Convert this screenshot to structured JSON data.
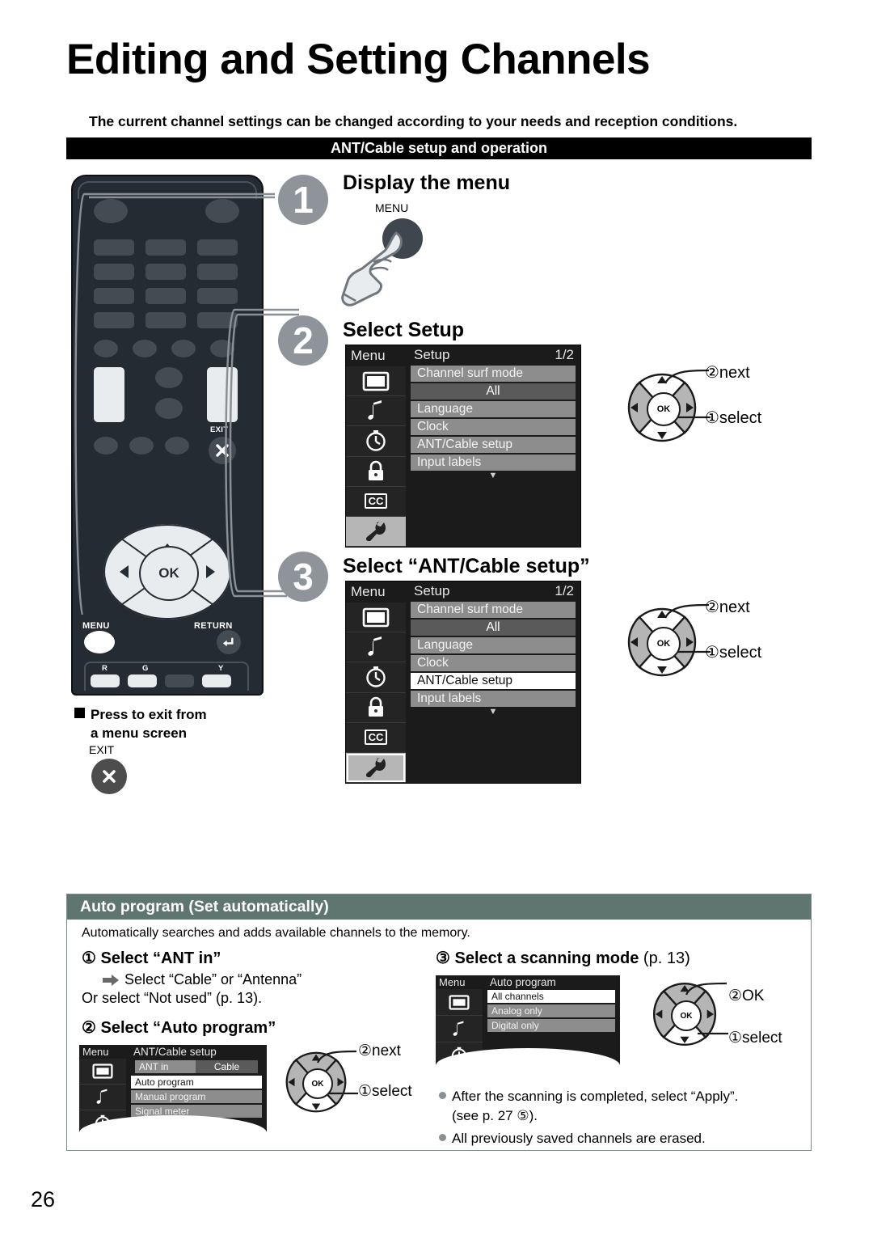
{
  "page": {
    "title": "Editing and Setting Channels",
    "lead": "The current channel settings can be changed according to your needs and reception conditions.",
    "section_bar": "ANT/Cable setup and operation",
    "page_number": "26"
  },
  "steps": [
    {
      "badge": "1",
      "title": "Display the menu",
      "button_label": "MENU"
    },
    {
      "badge": "2",
      "title": "Select Setup"
    },
    {
      "badge": "3",
      "title": "Select “ANT/Cable setup”"
    }
  ],
  "remote": {
    "labels": {
      "exit": "EXIT",
      "menu": "MENU",
      "return": "RETURN",
      "ok": "OK",
      "r": "R",
      "g": "G",
      "y": "Y"
    }
  },
  "exit_note": {
    "line1": "Press to exit from",
    "line2": "a menu screen",
    "button_label": "EXIT"
  },
  "menu_setup_1": {
    "side_title": "Menu",
    "header_title": "Setup",
    "header_page": "1/2",
    "rows": [
      {
        "label": "Channel surf mode",
        "type": "row"
      },
      {
        "label": "All",
        "type": "value"
      },
      {
        "label": "Language",
        "type": "row"
      },
      {
        "label": "Clock",
        "type": "row"
      },
      {
        "label": "ANT/Cable setup",
        "type": "row"
      },
      {
        "label": "Input labels",
        "type": "row"
      }
    ],
    "caret": "▼",
    "icons": [
      "picture-icon",
      "audio-icon",
      "timer-icon",
      "lock-icon",
      "cc-icon",
      "setup-icon"
    ],
    "selected_icon_index": 5
  },
  "menu_setup_2": {
    "side_title": "Menu",
    "header_title": "Setup",
    "header_page": "1/2",
    "rows": [
      {
        "label": "Channel surf mode",
        "type": "row"
      },
      {
        "label": "All",
        "type": "value"
      },
      {
        "label": "Language",
        "type": "row"
      },
      {
        "label": "Clock",
        "type": "row"
      },
      {
        "label": "ANT/Cable setup",
        "type": "highlight"
      },
      {
        "label": "Input labels",
        "type": "row"
      }
    ],
    "caret": "▼",
    "icons": [
      "picture-icon",
      "audio-icon",
      "timer-icon",
      "lock-icon",
      "cc-icon",
      "setup-icon"
    ],
    "selected_icon_index": 5
  },
  "dpads": [
    {
      "id": "dpad-step2",
      "ok_label": "OK",
      "label_top": "②next",
      "label_bottom": "①select",
      "filled": [
        "left",
        "right"
      ]
    },
    {
      "id": "dpad-step3",
      "ok_label": "OK",
      "label_top": "②next",
      "label_bottom": "①select",
      "filled": [
        "left",
        "right"
      ]
    },
    {
      "id": "dpad-auto-program",
      "ok_label": "OK",
      "label_top": "②next",
      "label_bottom": "①select",
      "filled": [
        "up",
        "left",
        "right"
      ]
    },
    {
      "id": "dpad-scanning-mode",
      "ok_label": "OK",
      "label_top": "②OK",
      "label_bottom": "①select",
      "filled": [
        "up",
        "left",
        "right"
      ]
    }
  ],
  "auto_program": {
    "heading": "Auto program (Set automatically)",
    "intro": "Automatically searches and adds available channels to the memory.",
    "step1": {
      "num": "①",
      "title": "Select “ANT in”",
      "sub1": "Select “Cable” or “Antenna”",
      "sub2": "Or select “Not used” (p. 13)."
    },
    "step2": {
      "num": "②",
      "title": "Select “Auto program”"
    },
    "step3": {
      "num": "③",
      "title": "Select a  scanning mode",
      "ref": "(p. 13)"
    },
    "menu_ant_cable": {
      "side_title": "Menu",
      "header_title": "ANT/Cable setup",
      "rows": [
        {
          "label": "ANT in",
          "value": "Cable",
          "type": "split"
        },
        {
          "label": "Auto program",
          "type": "highlight"
        },
        {
          "label": "Manual program",
          "type": "row"
        },
        {
          "label": "Signal meter",
          "type": "row"
        }
      ],
      "icons": [
        "picture-icon",
        "audio-icon",
        "timer-icon"
      ]
    },
    "menu_auto_program": {
      "side_title": "Menu",
      "header_title": "Auto program",
      "rows": [
        {
          "label": "All channels",
          "type": "highlight"
        },
        {
          "label": "Analog only",
          "type": "row"
        },
        {
          "label": "Digital only",
          "type": "row"
        }
      ],
      "icons": [
        "picture-icon",
        "audio-icon",
        "timer-icon"
      ]
    },
    "notes": [
      "After the scanning is completed, select “Apply”.",
      "(see p. 27 ⑤).",
      "All previously saved channels are erased."
    ]
  },
  "colors": {
    "badge_gray": "#8e9499",
    "section_header": "#5f7570",
    "black_bar": "#000000",
    "remote_body": "#242b33",
    "menu_bg": "#1b1b1b",
    "menu_row": "#8d8d8d"
  }
}
